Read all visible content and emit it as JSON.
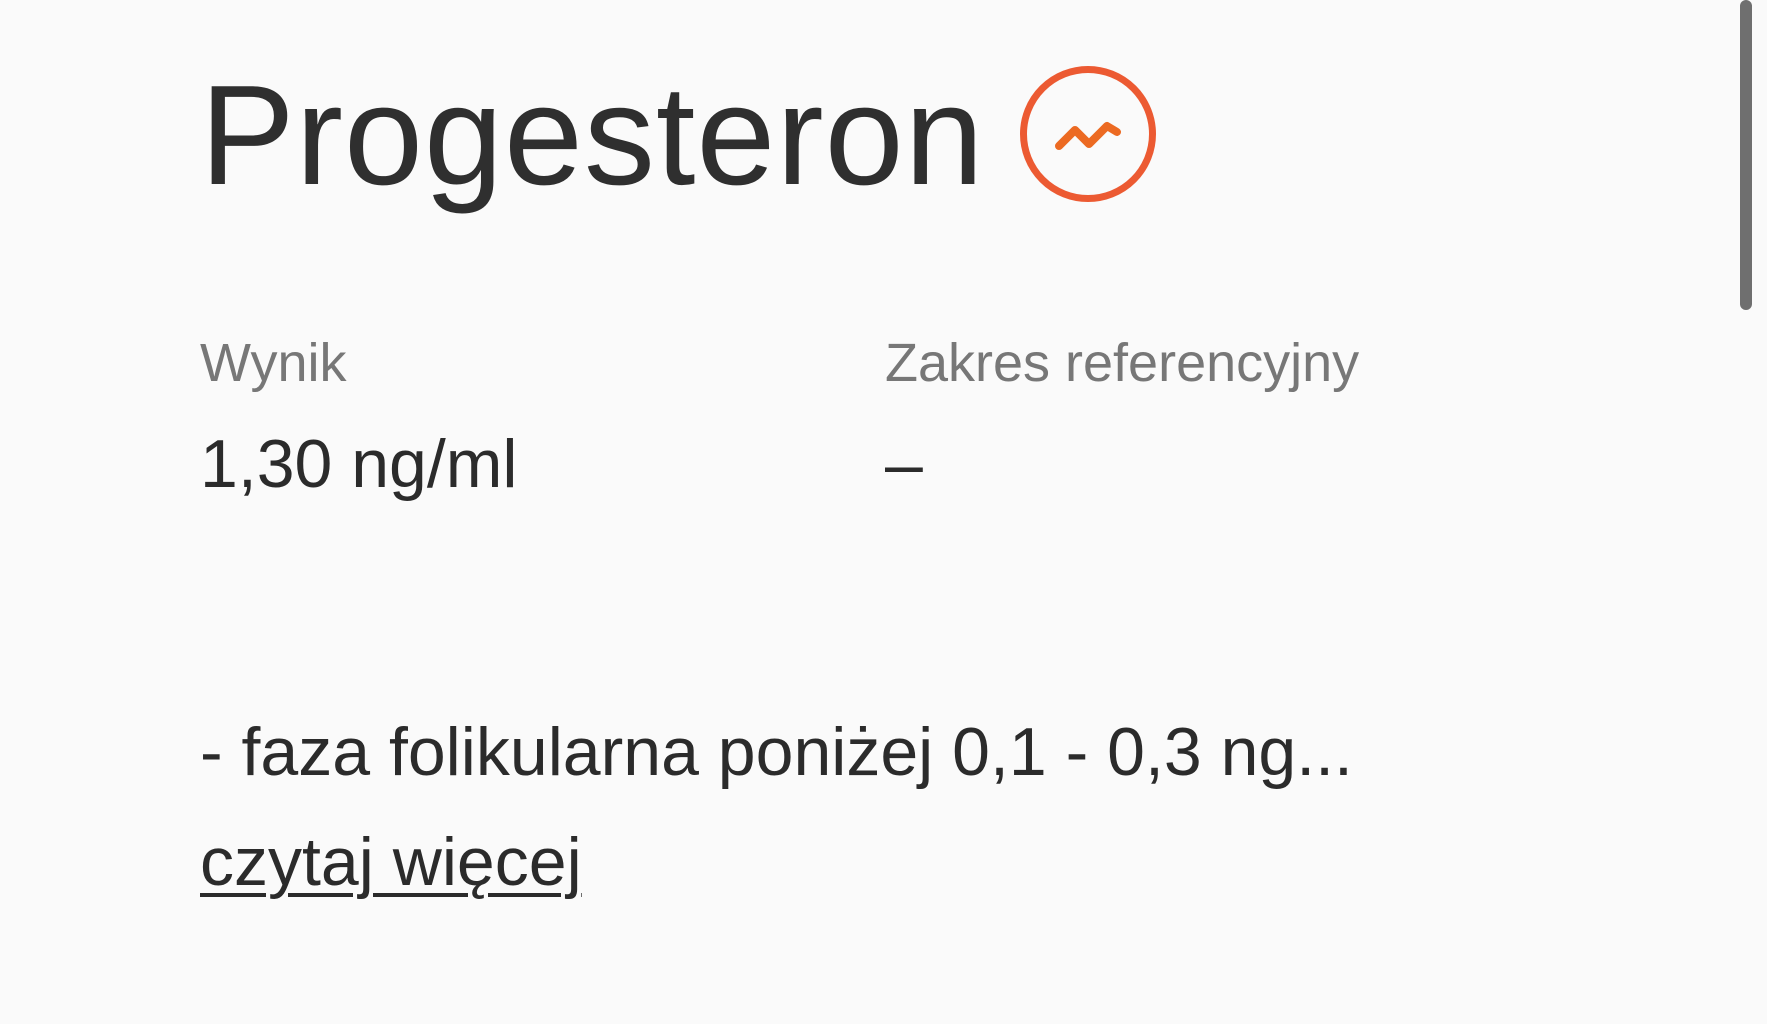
{
  "test": {
    "name": "Progesteron",
    "trend_icon": "trend-line-icon",
    "accent_color": "#ec5a32"
  },
  "result": {
    "label": "Wynik",
    "value": "1,30 ng/ml"
  },
  "reference": {
    "label": "Zakres referencyjny",
    "value": "–"
  },
  "note": {
    "text": "- faza folikularna poniżej 0,1 - 0,3 ng...",
    "read_more": "czytaj więcej"
  }
}
